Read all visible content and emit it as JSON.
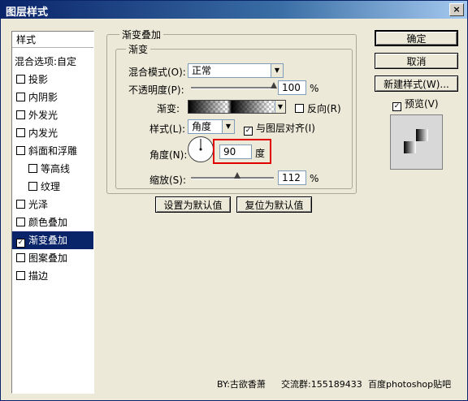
{
  "window": {
    "title": "图层样式",
    "close_label": "×"
  },
  "sidebar": {
    "header": "样式",
    "items": [
      {
        "label": "混合选项:自定",
        "checkbox": false,
        "checked": false,
        "active": false
      },
      {
        "label": "投影",
        "checkbox": true,
        "checked": false,
        "active": false
      },
      {
        "label": "内阴影",
        "checkbox": true,
        "checked": false,
        "active": false
      },
      {
        "label": "外发光",
        "checkbox": true,
        "checked": false,
        "active": false
      },
      {
        "label": "内发光",
        "checkbox": true,
        "checked": false,
        "active": false
      },
      {
        "label": "斜面和浮雕",
        "checkbox": true,
        "checked": false,
        "active": false
      },
      {
        "label": "等高线",
        "checkbox": true,
        "checked": false,
        "active": false,
        "indent": true
      },
      {
        "label": "纹理",
        "checkbox": true,
        "checked": false,
        "active": false,
        "indent": true
      },
      {
        "label": "光泽",
        "checkbox": true,
        "checked": false,
        "active": false
      },
      {
        "label": "颜色叠加",
        "checkbox": true,
        "checked": false,
        "active": false
      },
      {
        "label": "渐变叠加",
        "checkbox": true,
        "checked": true,
        "active": true
      },
      {
        "label": "图案叠加",
        "checkbox": true,
        "checked": false,
        "active": false
      },
      {
        "label": "描边",
        "checkbox": true,
        "checked": false,
        "active": false
      }
    ]
  },
  "panel": {
    "group_title": "渐变叠加",
    "subgroup_title": "渐变",
    "blend_mode_label": "混合模式(O):",
    "blend_mode_value": "正常",
    "opacity_label": "不透明度(P):",
    "opacity_value": "100",
    "opacity_fraction": 1.0,
    "percent": "%",
    "gradient_label": "渐变:",
    "reverse_label": "反向(R)",
    "reverse_checked": false,
    "style_label": "样式(L):",
    "style_value": "角度",
    "align_label": "与图层对齐(I)",
    "align_checked": true,
    "angle_label": "角度(N):",
    "angle_value": "90",
    "angle_unit": "度",
    "scale_label": "缩放(S):",
    "scale_value": "112",
    "scale_fraction": 0.56,
    "set_default_label": "设置为默认值",
    "reset_default_label": "复位为默认值"
  },
  "actions": {
    "ok_label": "确定",
    "cancel_label": "取消",
    "new_style_label": "新建样式(W)...",
    "preview_label": "预览(V)",
    "preview_checked": true
  },
  "footer": {
    "author": "BY:古欲香萧",
    "group": "交流群:155189433",
    "source": "百度photoshop贴吧"
  },
  "colors": {
    "highlight_box": "#e00000",
    "active_item": "#0a246a",
    "title_bar": "#0a246a"
  }
}
